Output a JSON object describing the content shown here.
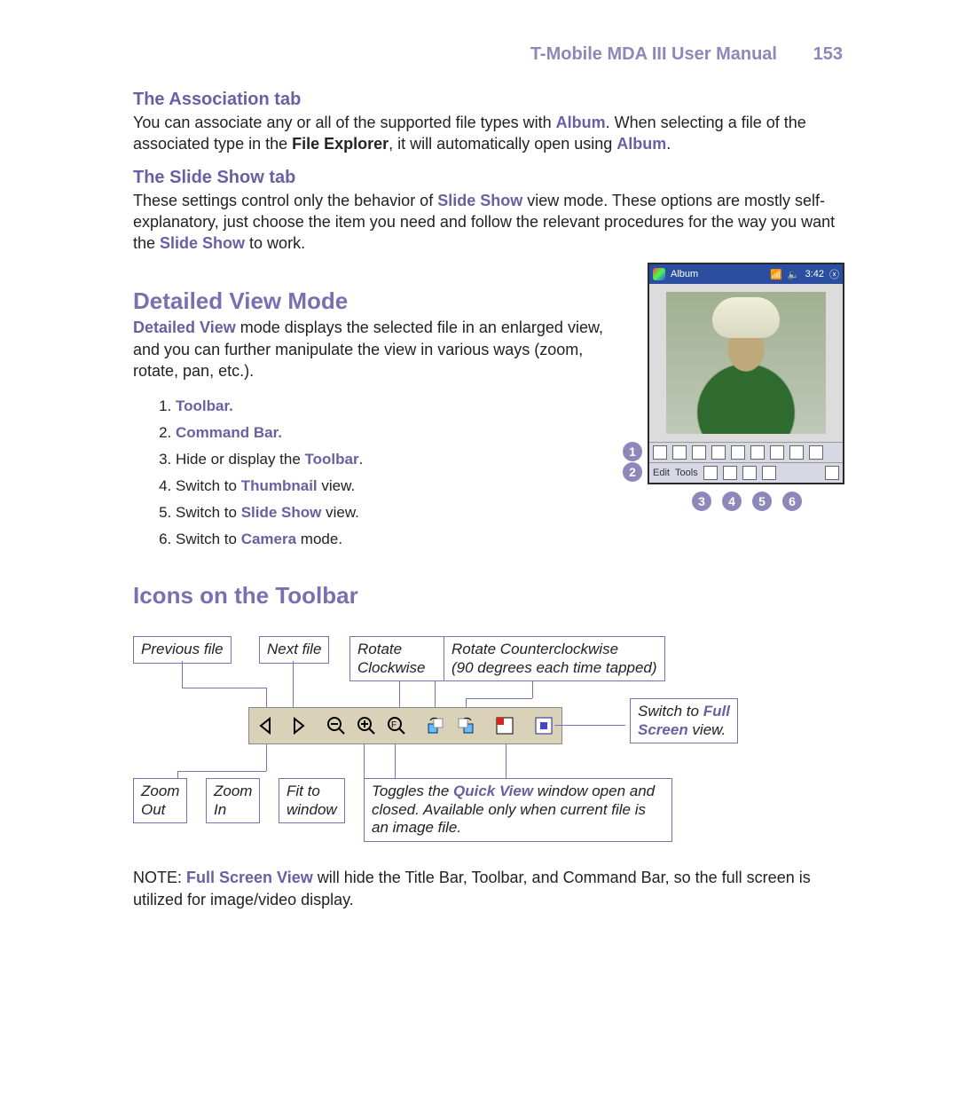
{
  "header": {
    "title": "T-Mobile MDA III User Manual",
    "page": "153"
  },
  "assoc": {
    "heading": "The Association tab",
    "p1a": "You can associate any or all of the supported file types with ",
    "album": "Album",
    "p1b": ".  When selecting a file of the associated type in the ",
    "fileexp": "File Explorer",
    "p1c": ", it will automatically open using ",
    "p1d": "."
  },
  "slide": {
    "heading": "The Slide Show tab",
    "p1a": "These settings control only the behavior of ",
    "ss": "Slide Show",
    "p1b": " view mode.  These options are mostly self-explanatory, just choose the item you need and follow the relevant procedures for the way you want the ",
    "p1c": " to work."
  },
  "detail": {
    "heading": "Detailed View Mode",
    "p1a": "Detailed View",
    "p1b": " mode displays the selected file in an enlarged view, and you can further manipulate the view in various ways (zoom, rotate, pan, etc.).",
    "list": {
      "i1": "Toolbar.",
      "i2": "Command Bar.",
      "i3a": "Hide or display the ",
      "i3b": "Toolbar",
      "i3c": ".",
      "i4a": "Switch to ",
      "i4b": "Thumbnail",
      "i4c": " view.",
      "i5a": "Switch to ",
      "i5b": "Slide Show",
      "i5c": " view.",
      "i6a": "Switch to ",
      "i6b": "Camera",
      "i6c": " mode."
    }
  },
  "phone": {
    "title": "Album",
    "time": "3:42",
    "cmd_edit": "Edit",
    "cmd_tools": "Tools"
  },
  "badges": {
    "b1": "1",
    "b2": "2",
    "b3": "3",
    "b4": "4",
    "b5": "5",
    "b6": "6"
  },
  "icons_heading": "Icons on the Toolbar",
  "callouts": {
    "prev": "Previous file",
    "next": "Next file",
    "rot_cw1": "Rotate",
    "rot_cw2": "Clockwise",
    "rot_ccw1": "Rotate Counterclockwise",
    "rot_ccw2": "90 degrees each time tapped)",
    "fs1": "Switch to ",
    "fs2": "Full",
    "fs3": "Screen",
    "fs4": " view.",
    "zoomout1": "Zoom",
    "zoomout2": "Out",
    "zoomin1": "Zoom",
    "zoomin2": "In",
    "fit1": "Fit to",
    "fit2": "window",
    "qv1": "Toggles the ",
    "qv2": "Quick View",
    "qv3": " window open and closed. Available only when current file is an image file."
  },
  "note": {
    "prefix": "NOTE:  ",
    "fsv": "Full Screen View",
    "body": " will hide the Title Bar, Toolbar, and Command Bar, so the full screen is utilized for image/video display."
  }
}
